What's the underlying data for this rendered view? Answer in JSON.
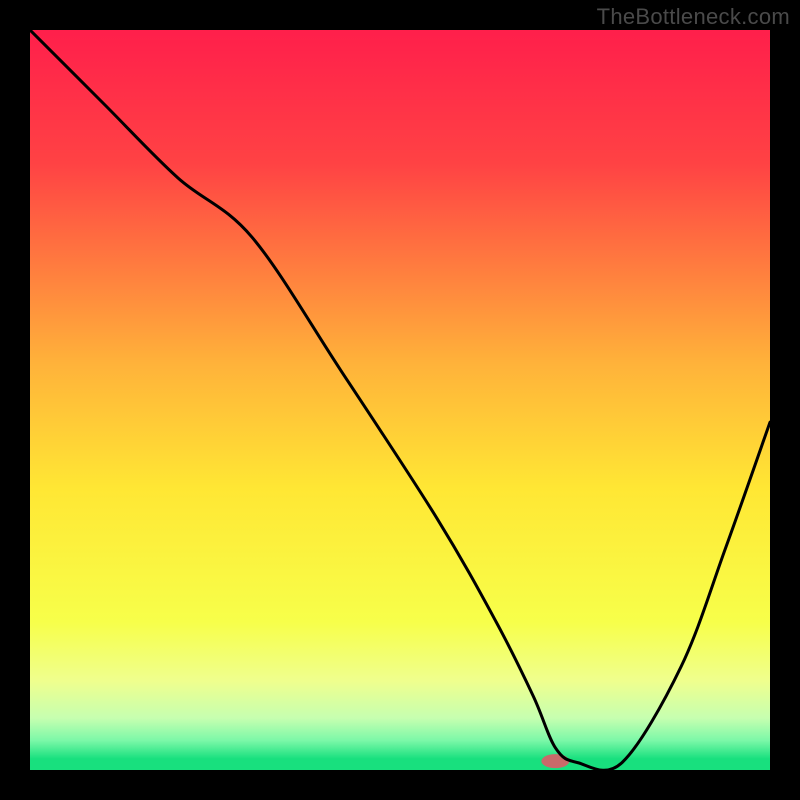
{
  "watermark": "TheBottleneck.com",
  "chart_data": {
    "type": "line",
    "title": "",
    "xlabel": "",
    "ylabel": "",
    "xlim": [
      0,
      100
    ],
    "ylim": [
      0,
      100
    ],
    "background_gradient": {
      "stops": [
        {
          "offset": 0,
          "color": "#ff1f4b"
        },
        {
          "offset": 18,
          "color": "#ff4244"
        },
        {
          "offset": 45,
          "color": "#ffb23a"
        },
        {
          "offset": 62,
          "color": "#ffe734"
        },
        {
          "offset": 80,
          "color": "#f7ff4a"
        },
        {
          "offset": 88,
          "color": "#efff8e"
        },
        {
          "offset": 93,
          "color": "#c6ffb0"
        },
        {
          "offset": 96,
          "color": "#7cf8a8"
        },
        {
          "offset": 98.5,
          "color": "#18e07e"
        },
        {
          "offset": 100,
          "color": "#18e07e"
        }
      ]
    },
    "series": [
      {
        "name": "bottleneck-curve",
        "x": [
          0,
          10,
          20,
          30,
          42,
          55,
          63,
          68,
          71,
          74,
          80,
          88,
          94,
          100
        ],
        "y": [
          100,
          90,
          80,
          72,
          54,
          34,
          20,
          10,
          3,
          1,
          1,
          14,
          30,
          47
        ]
      }
    ],
    "marker": {
      "name": "optimal-point",
      "x": 71,
      "y": 1.2,
      "color": "#c96a6a",
      "rx": 14,
      "ry": 7
    }
  }
}
